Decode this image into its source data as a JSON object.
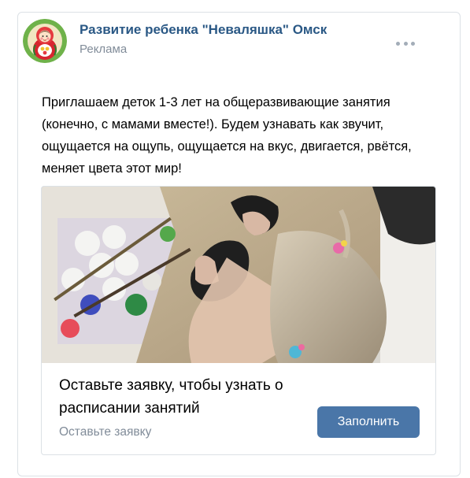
{
  "post": {
    "author": "Развитие ребенка \"Неваляшка\" Омск",
    "sponsored_label": "Реклама",
    "more_icon": "more-dots-icon",
    "text": "Приглашаем деток 1-3 лет на общеразвивающие занятия (конечно, с мамами вместе!). Будем узнавать как звучит, ощущается на ощупь, ощущается на вкус, двигается, рвётся, меняет цвета этот мир!"
  },
  "attachment": {
    "image_description": "child finger painting with black paint on brown paper",
    "title": "Оставьте заявку, чтобы узнать о расписании занятий",
    "caption": "Оставьте заявку",
    "button_label": "Заполнить"
  },
  "colors": {
    "author_link": "#2a5885",
    "secondary_text": "#818c99",
    "button_bg": "#4a76a8",
    "border": "#dce1e6"
  }
}
